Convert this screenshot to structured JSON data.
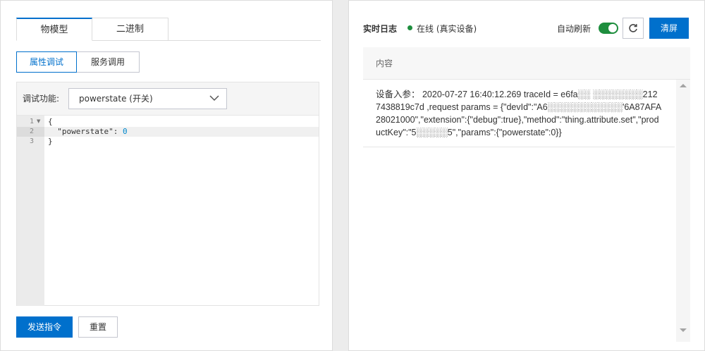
{
  "left": {
    "tabs": [
      "物模型",
      "二进制"
    ],
    "subtabs": [
      "属性调试",
      "服务调用"
    ],
    "function_label": "调试功能:",
    "function_value": "powerstate (开关)",
    "editor": {
      "line_numbers": [
        "1",
        "2",
        "3"
      ],
      "lines": [
        "{",
        "  \"powerstate\": ",
        "}"
      ],
      "powerstate_value": "0"
    },
    "buttons": {
      "send": "发送指令",
      "reset": "重置"
    }
  },
  "right": {
    "title": "实时日志",
    "status": "在线 (真实设备)",
    "status_color": "#1e8e3e",
    "auto_refresh_label": "自动刷新",
    "auto_refresh_on": true,
    "refresh_icon": "refresh-icon",
    "clear_label": "清屏",
    "table_header": "内容",
    "log_entries": [
      "设备入参： 2020-07-27 16:40:12.269 traceId = e6fa░░ ░░░░░░░░2127438819c7d ,request params = {\"devId\":\"A6░░░░░░░░░░░░'6A87AFA28021000\",\"extension\":{\"debug\":true},\"method\":\"thing.attribute.set\",\"productKey\":\"5░░░░░5\",\"params\":{\"powerstate\":0}}"
    ]
  },
  "colors": {
    "primary": "#0070cc",
    "online": "#1e8e3e"
  }
}
